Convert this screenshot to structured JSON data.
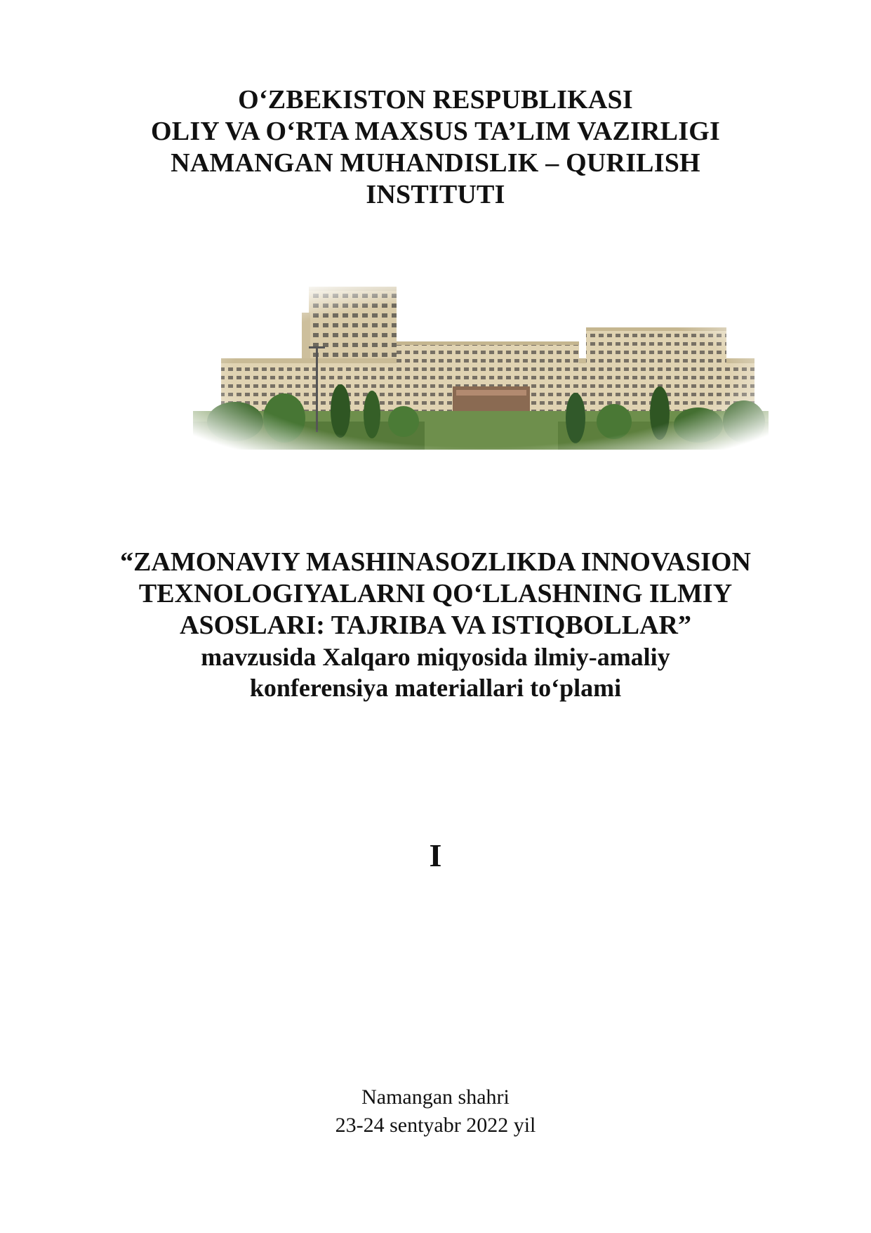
{
  "header": {
    "lines": [
      "O‘ZBEKISTON RESPUBLIKASI",
      "OLIY VA O‘RTA MAXSUS TA’LIM VAZIRLIGI",
      "NAMANGAN MUHANDISLIK – QURILISH",
      "INSTITUTI"
    ]
  },
  "photo": {
    "icon": "institute-building-photo"
  },
  "title": {
    "lines": [
      "“ZAMONAVIY MASHINASOZLIKDA INNOVASION",
      "TEXNOLOGIYALARNI QO‘LLASHNING ILMIY",
      "ASOSLARI: TAJRIBA VA ISTIQBOLLAR”"
    ],
    "subtitle_lines": [
      "mavzusida Xalqaro miqyosida ilmiy-amaliy",
      "konferensiya materiallari to‘plami"
    ]
  },
  "volume": "I",
  "footer": {
    "city": "Namangan shahri",
    "date": "23-24 sentyabr 2022 yil"
  }
}
